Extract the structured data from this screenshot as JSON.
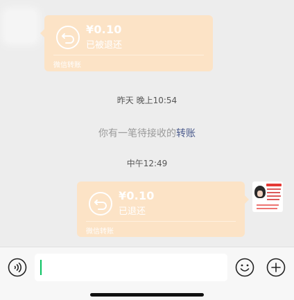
{
  "messages": {
    "received_transfer": {
      "amount": "¥0.10",
      "status": "已被退还",
      "footer": "微信转账"
    },
    "time_yesterday": "昨天 晚上10:54",
    "system_notice": {
      "text": "你有一笔待接收的",
      "link": "转账"
    },
    "time_noon": "中午12:49",
    "sent_transfer": {
      "amount": "¥0.10",
      "status": "已退还",
      "footer": "微信转账"
    }
  },
  "colors": {
    "transfer_card": "#fce3c6",
    "link": "#4a5a8c",
    "caret": "#07c160"
  },
  "input_bar": {
    "text_value": ""
  }
}
